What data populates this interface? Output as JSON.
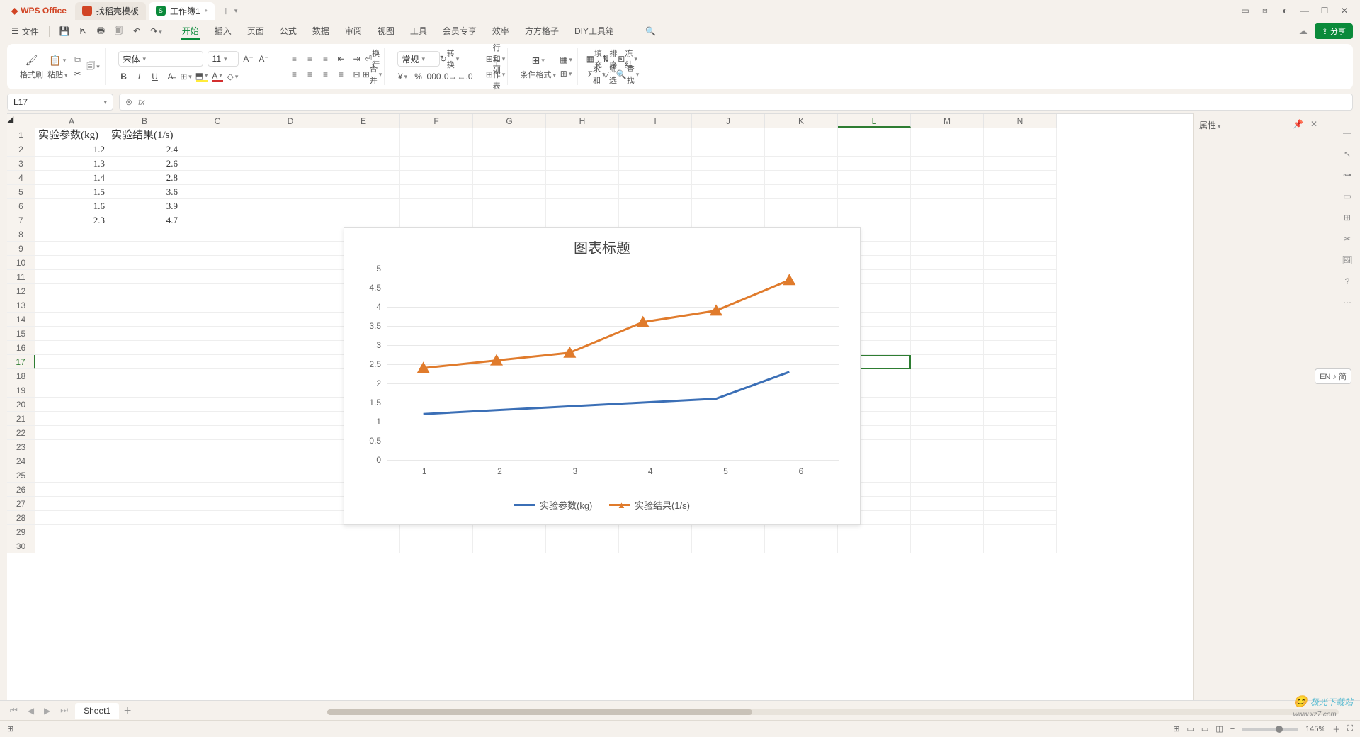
{
  "app_name": "WPS Office",
  "tabs": [
    {
      "label": "找稻壳模板",
      "icon_color": "#d14424"
    },
    {
      "label": "工作簿1",
      "icon_color": "#0a8a3a",
      "active": true
    }
  ],
  "menu": {
    "file": "文件",
    "items": [
      "开始",
      "插入",
      "页面",
      "公式",
      "数据",
      "审阅",
      "视图",
      "工具",
      "会员专享",
      "效率",
      "方方格子",
      "DIY工具箱"
    ],
    "active": "开始",
    "share": "分享"
  },
  "ribbon": {
    "format_painter": "格式刷",
    "paste": "粘贴",
    "font_name": "宋体",
    "font_size": "11",
    "number_format": "常规",
    "convert": "转换",
    "wrap": "换行",
    "rowcol": "行和列",
    "worksheet": "工作表",
    "merge": "合并",
    "cond_format": "条件格式",
    "fill": "填充",
    "sum": "求和",
    "sort": "排序",
    "filter": "筛选",
    "freeze": "冻结",
    "find": "查找"
  },
  "namebox": "L17",
  "fx_label": "fx",
  "columns": [
    "A",
    "B",
    "C",
    "D",
    "E",
    "F",
    "G",
    "H",
    "I",
    "J",
    "K",
    "L",
    "M",
    "N"
  ],
  "selected_col": "L",
  "selected_row": 17,
  "row_count": 30,
  "sheet": {
    "headers": [
      "实验参数(kg)",
      "实验结果(1/s)"
    ],
    "rows": [
      [
        "1.2",
        "2.4"
      ],
      [
        "1.3",
        "2.6"
      ],
      [
        "1.4",
        "2.8"
      ],
      [
        "1.5",
        "3.6"
      ],
      [
        "1.6",
        "3.9"
      ],
      [
        "2.3",
        "4.7"
      ]
    ]
  },
  "chart_data": {
    "type": "line",
    "title": "图表标题",
    "categories": [
      "1",
      "2",
      "3",
      "4",
      "5",
      "6"
    ],
    "series": [
      {
        "name": "实验参数(kg)",
        "values": [
          1.2,
          1.3,
          1.4,
          1.5,
          1.6,
          2.3
        ],
        "color": "#3b6fb6",
        "marker": "none"
      },
      {
        "name": "实验结果(1/s)",
        "values": [
          2.4,
          2.6,
          2.8,
          3.6,
          3.9,
          4.7
        ],
        "color": "#e07b2c",
        "marker": "triangle"
      }
    ],
    "ylim": [
      0,
      5
    ],
    "ystep": 0.5,
    "xlabel": "",
    "ylabel": ""
  },
  "sheet_tab": "Sheet1",
  "prop_panel": "属性",
  "zoom": "145%",
  "lang_badge": "EN ♪ 简",
  "watermark": "极光下载站",
  "watermark_url": "www.xz7.com"
}
